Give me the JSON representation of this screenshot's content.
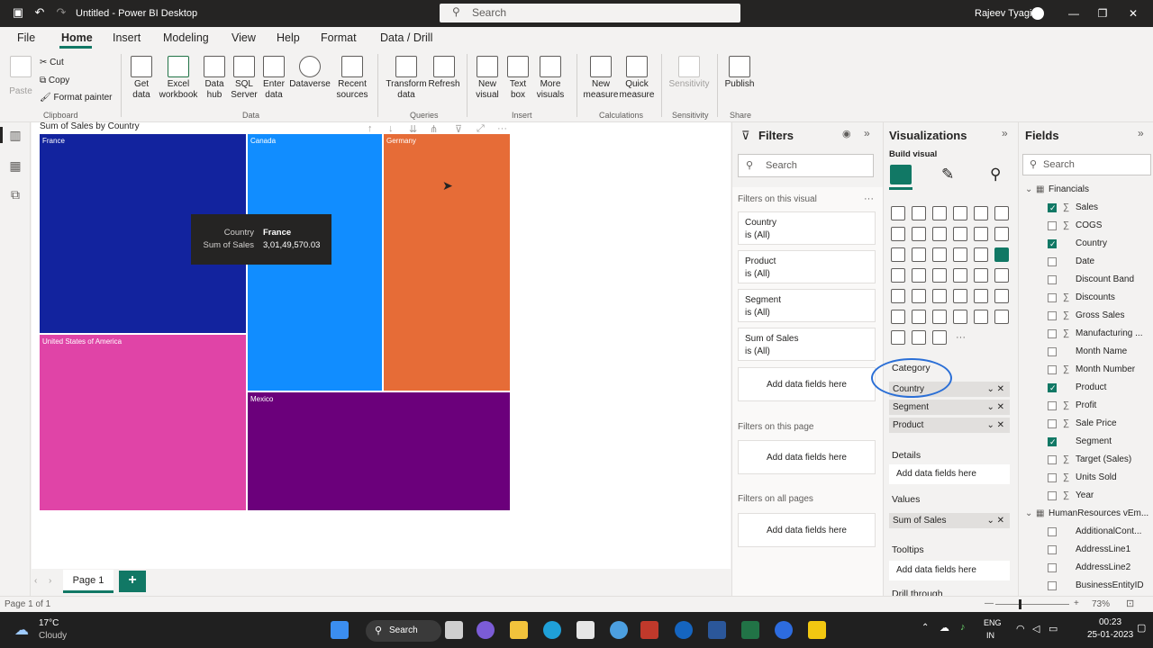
{
  "app": {
    "title": "Untitled - Power BI Desktop",
    "search_placeholder": "Search",
    "user": "Rajeev Tyagi"
  },
  "menu": {
    "tabs": [
      "File",
      "Home",
      "Insert",
      "Modeling",
      "View",
      "Help",
      "Format",
      "Data / Drill"
    ],
    "active": "Home"
  },
  "ribbon": {
    "clipboard": {
      "paste": "Paste",
      "cut": "Cut",
      "copy": "Copy",
      "format_painter": "Format painter",
      "label": "Clipboard"
    },
    "data": {
      "get_data": [
        "Get",
        "data"
      ],
      "excel": [
        "Excel",
        "workbook"
      ],
      "data_hub": [
        "Data",
        "hub"
      ],
      "sql": [
        "SQL",
        "Server"
      ],
      "enter": [
        "Enter",
        "data"
      ],
      "dataverse": "Dataverse",
      "recent": [
        "Recent",
        "sources"
      ],
      "label": "Data"
    },
    "queries": {
      "transform": [
        "Transform",
        "data"
      ],
      "refresh": "Refresh",
      "label": "Queries"
    },
    "insert": {
      "new_visual": [
        "New",
        "visual"
      ],
      "text_box": [
        "Text",
        "box"
      ],
      "more_visuals": [
        "More",
        "visuals"
      ],
      "label": "Insert"
    },
    "calculations": {
      "new_measure": [
        "New",
        "measure"
      ],
      "quick_measure": [
        "Quick",
        "measure"
      ],
      "label": "Calculations"
    },
    "sensitivity": {
      "btn": "Sensitivity",
      "label": "Sensitivity"
    },
    "share": {
      "publish": "Publish",
      "label": "Share"
    }
  },
  "visual": {
    "title": "Sum of Sales by Country"
  },
  "chart_data": {
    "type": "treemap",
    "title": "Sum of Sales by Country",
    "categories": [
      "France",
      "Canada",
      "Germany",
      "United States of America",
      "Mexico"
    ],
    "colors": [
      "#12239e",
      "#118dff",
      "#e66c37",
      "#e044a7",
      "#6b007b"
    ]
  },
  "tooltip": {
    "k1": "Country",
    "v1": "France",
    "k2": "Sum of Sales",
    "v2": "3,01,49,570.03"
  },
  "pages": {
    "tab": "Page 1",
    "add": "+",
    "status": "Page 1 of 1"
  },
  "filters": {
    "title": "Filters",
    "search": "Search",
    "on_visual": "Filters on this visual",
    "cards": [
      {
        "name": "Country",
        "state": "is (All)"
      },
      {
        "name": "Product",
        "state": "is (All)"
      },
      {
        "name": "Segment",
        "state": "is (All)"
      },
      {
        "name": "Sum of Sales",
        "state": "is (All)"
      }
    ],
    "add": "Add data fields here",
    "on_page": "Filters on this page",
    "on_all": "Filters on all pages"
  },
  "viz": {
    "title": "Visualizations",
    "build": "Build visual",
    "category_label": "Category",
    "category_items": [
      "Country",
      "Segment",
      "Product"
    ],
    "details_label": "Details",
    "values_label": "Values",
    "values_item": "Sum of Sales",
    "tooltips_label": "Tooltips",
    "drill_label": "Drill through",
    "add": "Add data fields here",
    "more": "···"
  },
  "fields": {
    "title": "Fields",
    "search": "Search",
    "table": "Financials",
    "items": [
      {
        "name": "Sales",
        "sigma": true,
        "checked": true
      },
      {
        "name": "COGS",
        "sigma": true,
        "checked": false
      },
      {
        "name": "Country",
        "sigma": false,
        "checked": true
      },
      {
        "name": "Date",
        "sigma": false,
        "checked": false
      },
      {
        "name": "Discount Band",
        "sigma": false,
        "checked": false
      },
      {
        "name": "Discounts",
        "sigma": true,
        "checked": false
      },
      {
        "name": "Gross Sales",
        "sigma": true,
        "checked": false
      },
      {
        "name": "Manufacturing ...",
        "sigma": true,
        "checked": false
      },
      {
        "name": "Month Name",
        "sigma": false,
        "checked": false
      },
      {
        "name": "Month Number",
        "sigma": true,
        "checked": false
      },
      {
        "name": "Product",
        "sigma": false,
        "checked": true
      },
      {
        "name": "Profit",
        "sigma": true,
        "checked": false
      },
      {
        "name": "Sale Price",
        "sigma": true,
        "checked": false
      },
      {
        "name": "Segment",
        "sigma": false,
        "checked": true
      },
      {
        "name": "Target (Sales)",
        "sigma": true,
        "checked": false
      },
      {
        "name": "Units Sold",
        "sigma": true,
        "checked": false
      },
      {
        "name": "Year",
        "sigma": true,
        "checked": false
      }
    ],
    "table2": "HumanResources vEm...",
    "items2": [
      "AdditionalCont...",
      "AddressLine1",
      "AddressLine2",
      "BusinessEntityID"
    ]
  },
  "zoom": {
    "value": "73%"
  },
  "taskbar": {
    "temp": "17°C",
    "weather": "Cloudy",
    "search": "Search",
    "lang1": "ENG",
    "lang2": "IN",
    "time": "00:23",
    "date": "25-01-2023"
  }
}
